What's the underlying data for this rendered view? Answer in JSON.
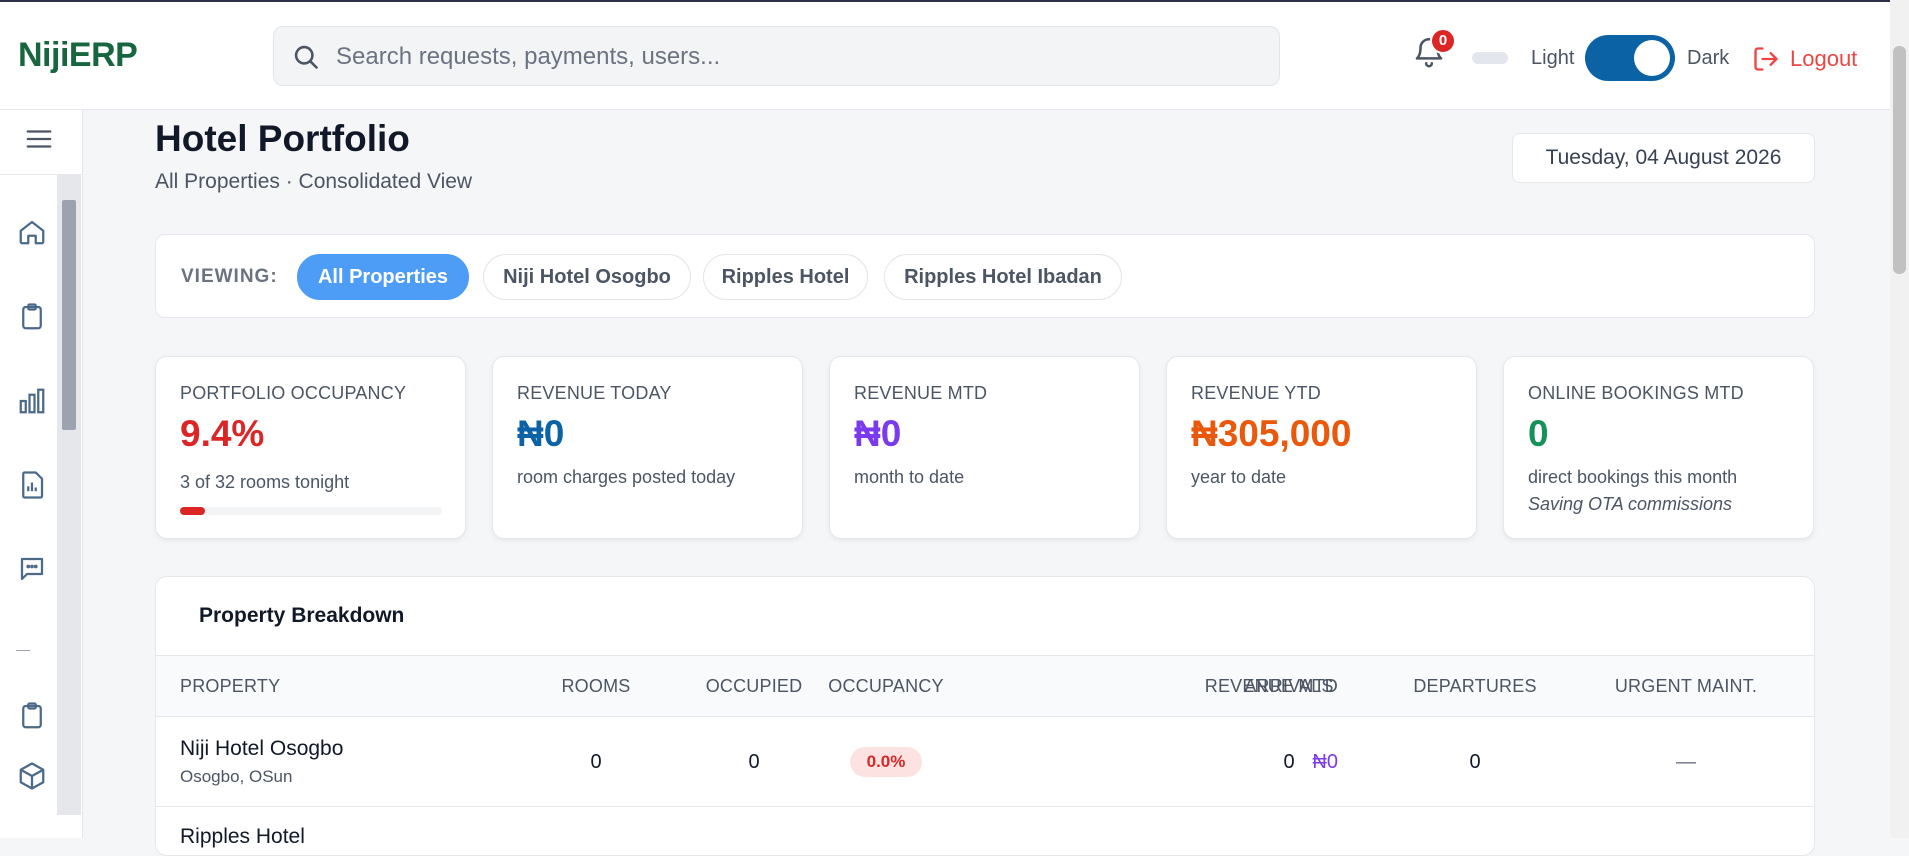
{
  "app": {
    "logo": "NijiERP"
  },
  "header": {
    "search_placeholder": "Search requests, payments, users...",
    "notifications_count": "0",
    "theme_light_label": "Light",
    "theme_dark_label": "Dark",
    "logout_label": "Logout"
  },
  "sidebar": {
    "icons": [
      "menu-icon",
      "home-icon",
      "clipboard-icon",
      "bar-chart-icon",
      "report-icon",
      "chat-icon",
      "clipboard-icon",
      "cube-icon"
    ]
  },
  "page": {
    "title": "Hotel Portfolio",
    "subtitle": "All Properties · Consolidated View",
    "date": "Tuesday, 04 August 2026"
  },
  "filter": {
    "label": "VIEWING:",
    "chips": [
      "All Properties",
      "Niji Hotel Osogbo",
      "Ripples Hotel",
      "Ripples Hotel Ibadan"
    ],
    "active": "All Properties"
  },
  "kpis": {
    "occupancy": {
      "label": "PORTFOLIO OCCUPANCY",
      "value": "9.4%",
      "sub": "3 of 32 rooms tonight",
      "progress": 0.094
    },
    "revenue_today": {
      "label": "REVENUE TODAY",
      "value": "₦0",
      "sub": "room charges posted today"
    },
    "revenue_mtd": {
      "label": "REVENUE MTD",
      "value": "₦0",
      "sub": "month to date"
    },
    "revenue_ytd": {
      "label": "REVENUE YTD",
      "value": "₦305,000",
      "sub": "year to date"
    },
    "online_bookings": {
      "label": "ONLINE BOOKINGS MTD",
      "value": "0",
      "sub": "direct bookings this month",
      "note": "Saving OTA commissions"
    }
  },
  "colors": {
    "occupancy": "#dc2626",
    "revenue_today": "#0b63a5",
    "revenue_mtd": "#7c3aed",
    "revenue_ytd": "#ea580c",
    "online_bookings": "#16915a"
  },
  "breakdown": {
    "title": "Property Breakdown",
    "columns": [
      "PROPERTY",
      "ROOMS",
      "OCCUPIED",
      "OCCUPANCY",
      "REVENUE MTD",
      "ARRIVALS",
      "DEPARTURES",
      "URGENT MAINT."
    ],
    "rows": [
      {
        "name": "Niji Hotel Osogbo",
        "location": "Osogbo, OSun",
        "rooms": "0",
        "occupied": "0",
        "occupancy": "0.0%",
        "revenue_mtd": "₦0",
        "arrivals": "0",
        "departures": "0",
        "urgent": "—"
      },
      {
        "name": "Ripples Hotel"
      }
    ]
  }
}
